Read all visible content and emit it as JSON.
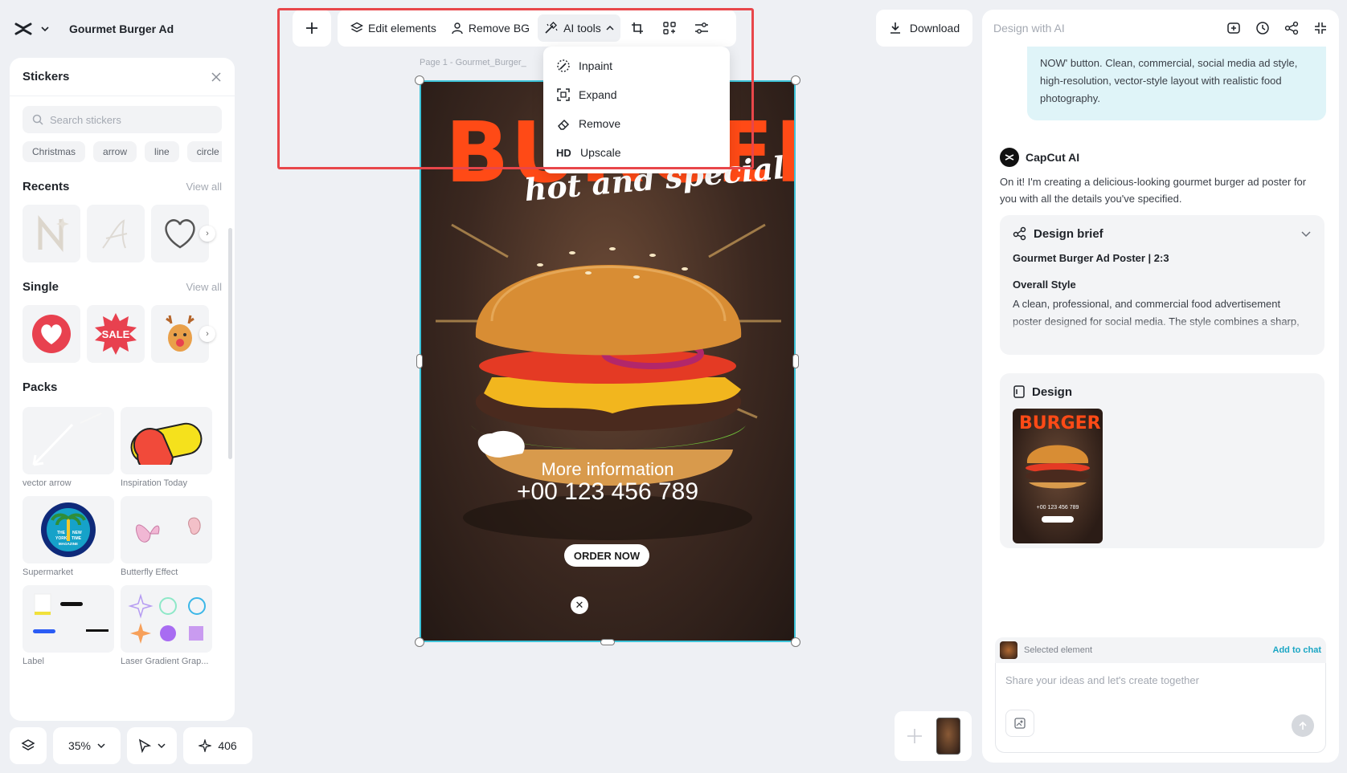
{
  "project": {
    "name": "Gourmet Burger Ad"
  },
  "toolbar": {
    "add_label": "+",
    "edit_elements": "Edit elements",
    "remove_bg": "Remove BG",
    "ai_tools": "AI tools"
  },
  "ai_tools_menu": [
    {
      "label": "Inpaint",
      "icon": "inpaint-icon"
    },
    {
      "label": "Expand",
      "icon": "expand-icon"
    },
    {
      "label": "Remove",
      "icon": "eraser-icon"
    },
    {
      "label": "Upscale",
      "icon_text": "HD"
    }
  ],
  "download": {
    "label": "Download"
  },
  "stickers": {
    "title": "Stickers",
    "search_placeholder": "Search stickers",
    "chips": [
      "Christmas",
      "arrow",
      "line",
      "circle"
    ],
    "recents": {
      "title": "Recents",
      "view_all": "View all"
    },
    "single": {
      "title": "Single",
      "view_all": "View all",
      "sale_text": "SALE"
    },
    "packs": {
      "title": "Packs",
      "items": [
        "vector arrow",
        "Inspiration Today",
        "Supermarket",
        "Butterfly Effect",
        "Label",
        "Laser Gradient Grap..."
      ]
    },
    "magazine_text": [
      "THE",
      "NEW",
      "YORK",
      "TIME",
      "MAGAZINE"
    ]
  },
  "bottom_controls": {
    "zoom": "35%",
    "credits": "406"
  },
  "canvas": {
    "page_label": "Page 1 -  Gourmet_Burger_",
    "headline": "BURGER",
    "tagline": "hot and special",
    "info_label": "More information",
    "phone": "+00 123 456 789",
    "cta": "ORDER NOW"
  },
  "right_panel": {
    "title": "Design with AI",
    "user_message": "NOW' button. Clean, commercial, social media ad style, high-resolution, vector-style layout with realistic food photography.",
    "ai_name": "CapCut AI",
    "ai_message": "On it! I'm creating a delicious-looking gourmet burger ad poster for you with all the details you've specified.",
    "brief": {
      "title": "Design brief",
      "subtitle": "Gourmet Burger Ad Poster | 2:3",
      "style_heading": "Overall Style",
      "style_text": "A clean, professional, and commercial food advertisement poster designed for social media. The style combines a sharp, vector-style layout with burger"
    },
    "design": {
      "title": "Design"
    },
    "chat": {
      "selected_label": "Selected element",
      "add_to_chat": "Add to chat",
      "placeholder": "Share your ideas and let's create together"
    }
  },
  "colors": {
    "accent_cyan": "#3ec3d8",
    "highlight_red": "#e8464a",
    "burger_orange": "#ff4a16",
    "link_teal": "#1aa6c4"
  }
}
